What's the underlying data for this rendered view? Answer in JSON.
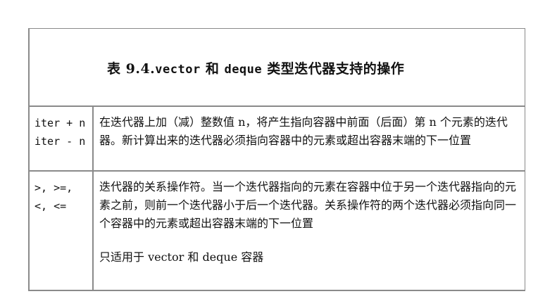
{
  "table": {
    "title": {
      "prefix": "表 9.4.",
      "code1": "vector",
      "mid": " 和 ",
      "code2": "deque",
      "suffix": " 类型迭代器支持的操作"
    },
    "rows": [
      {
        "ops": [
          "iter + n",
          "iter - n"
        ],
        "description": "在迭代器上加（减）整数值 n，将产生指向容器中前面（后面）第 n 个元素的迭代器。新计算出来的迭代器必须指向容器中的元素或超出容器末端的下一位置"
      },
      {
        "ops": [
          ">, >=,",
          "<, <="
        ],
        "description": "迭代器的关系操作符。当一个迭代器指向的元素在容器中位于另一个迭代器指向的元素之前，则前一个迭代器小于后一个迭代器。关系操作符的两个迭代器必须指向同一个容器中的元素或超出容器末端的下一位置",
        "note": "只适用于 vector 和 deque 容器"
      }
    ]
  }
}
